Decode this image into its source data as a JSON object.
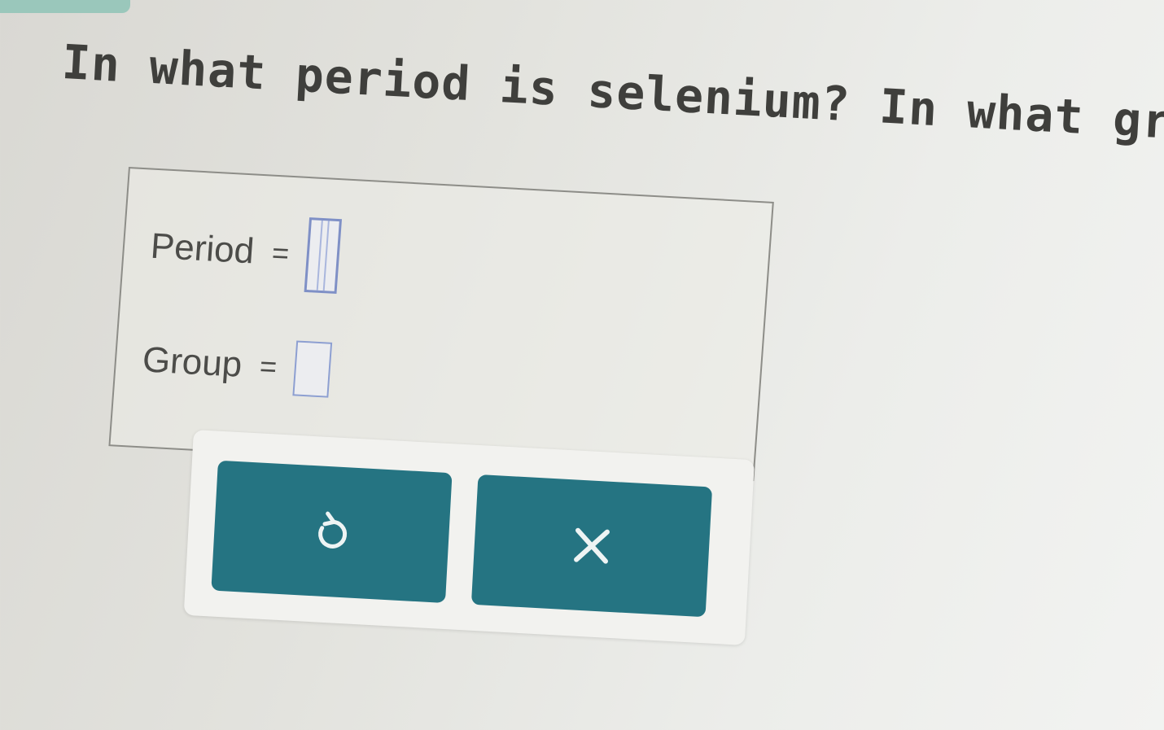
{
  "question": {
    "text": "In what period is selenium? In what group?"
  },
  "fields": [
    {
      "label": "Period",
      "equals": "=",
      "value": ""
    },
    {
      "label": "Group",
      "equals": "=",
      "value": ""
    }
  ],
  "buttons": {
    "undo": {
      "icon": "undo-icon"
    },
    "clear": {
      "icon": "close-icon"
    }
  },
  "colors": {
    "button": "#257482",
    "answer_box_border": "#8d9fd1",
    "accent": "#9ac7bb"
  }
}
